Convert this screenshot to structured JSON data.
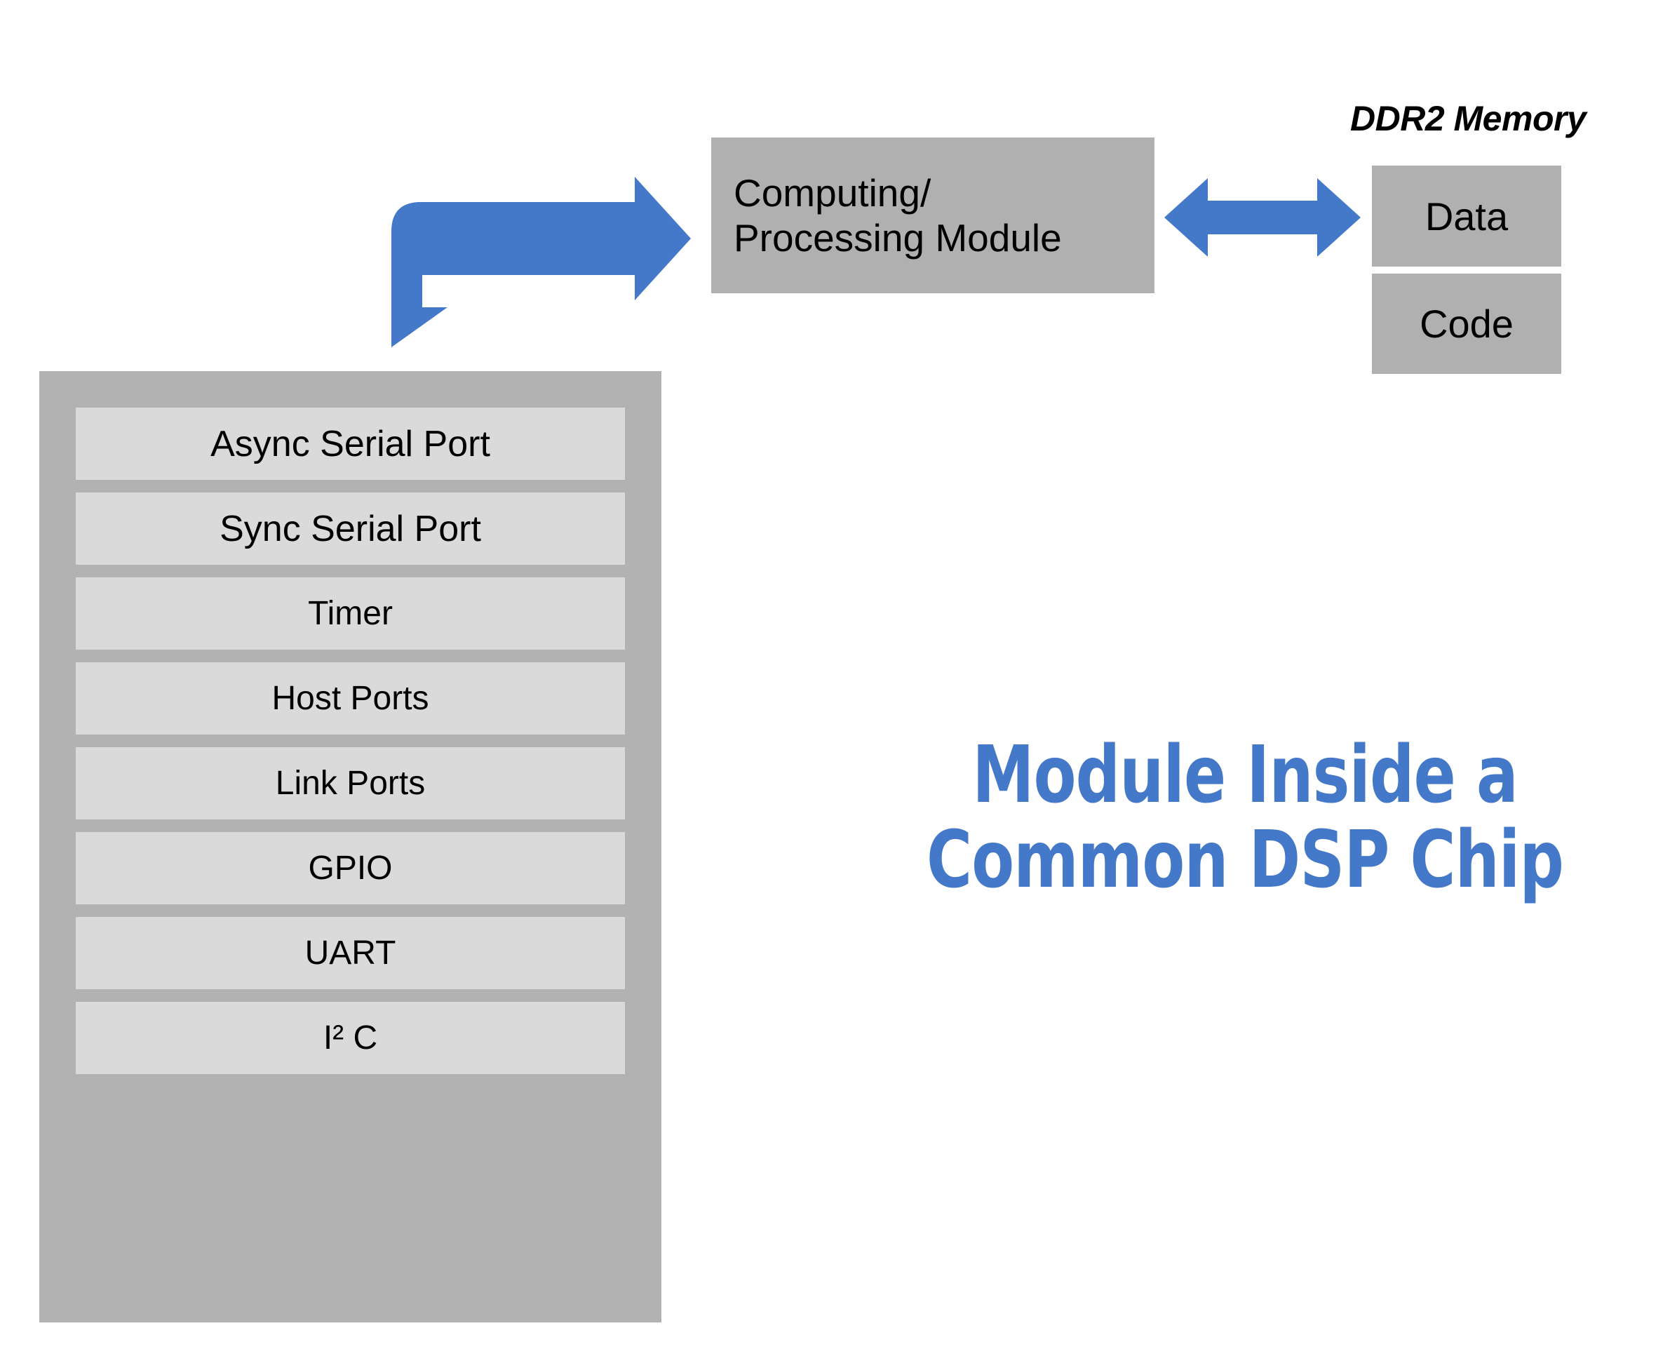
{
  "diagram": {
    "cpu_module": {
      "label": "Computing/\nProcessing Module"
    },
    "memory": {
      "group_label": "DDR2 Memory",
      "blocks": [
        {
          "label": "Data"
        },
        {
          "label": "Code"
        }
      ]
    },
    "peripherals": {
      "items": [
        {
          "label": "Async Serial Port"
        },
        {
          "label": "Sync Serial Port"
        },
        {
          "label": "Timer"
        },
        {
          "label": "Host Ports"
        },
        {
          "label": "Link Ports"
        },
        {
          "label": "GPIO"
        },
        {
          "label": "UART"
        },
        {
          "label": "I² C"
        }
      ]
    },
    "title": {
      "line1": "Module Inside a",
      "line2": "Common DSP Chip"
    },
    "arrows": [
      {
        "name": "module-to-peripherals",
        "kind": "elbow-double-head"
      },
      {
        "name": "module-to-memory",
        "kind": "double-head-horizontal"
      }
    ],
    "colors": {
      "accent_blue": "#4478c8",
      "box_gray": "#b0b0b0",
      "container_gray": "#b2b2b2",
      "item_gray": "#dadada",
      "background": "#ffffff",
      "text": "#000000"
    }
  }
}
